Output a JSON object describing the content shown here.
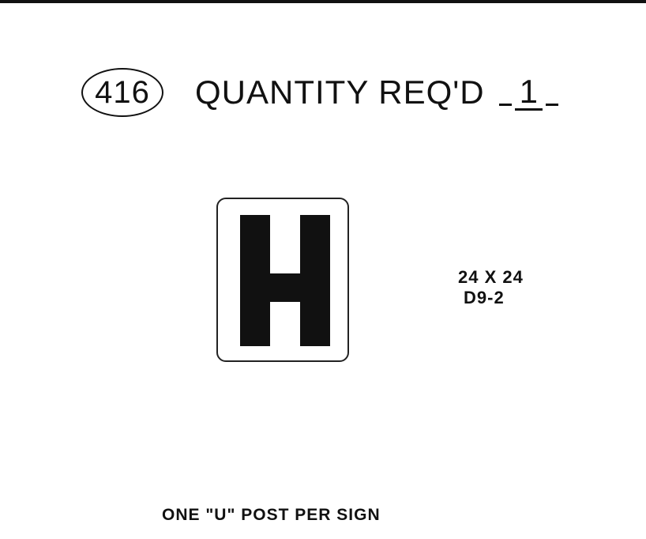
{
  "header": {
    "sheet_number": "416",
    "quantity_label": "QUANTITY REQ'D",
    "quantity_value": "1"
  },
  "sign": {
    "legend": "H",
    "size": "24 X 24",
    "code": "D9-2"
  },
  "note": "ONE \"U\" POST PER SIGN"
}
